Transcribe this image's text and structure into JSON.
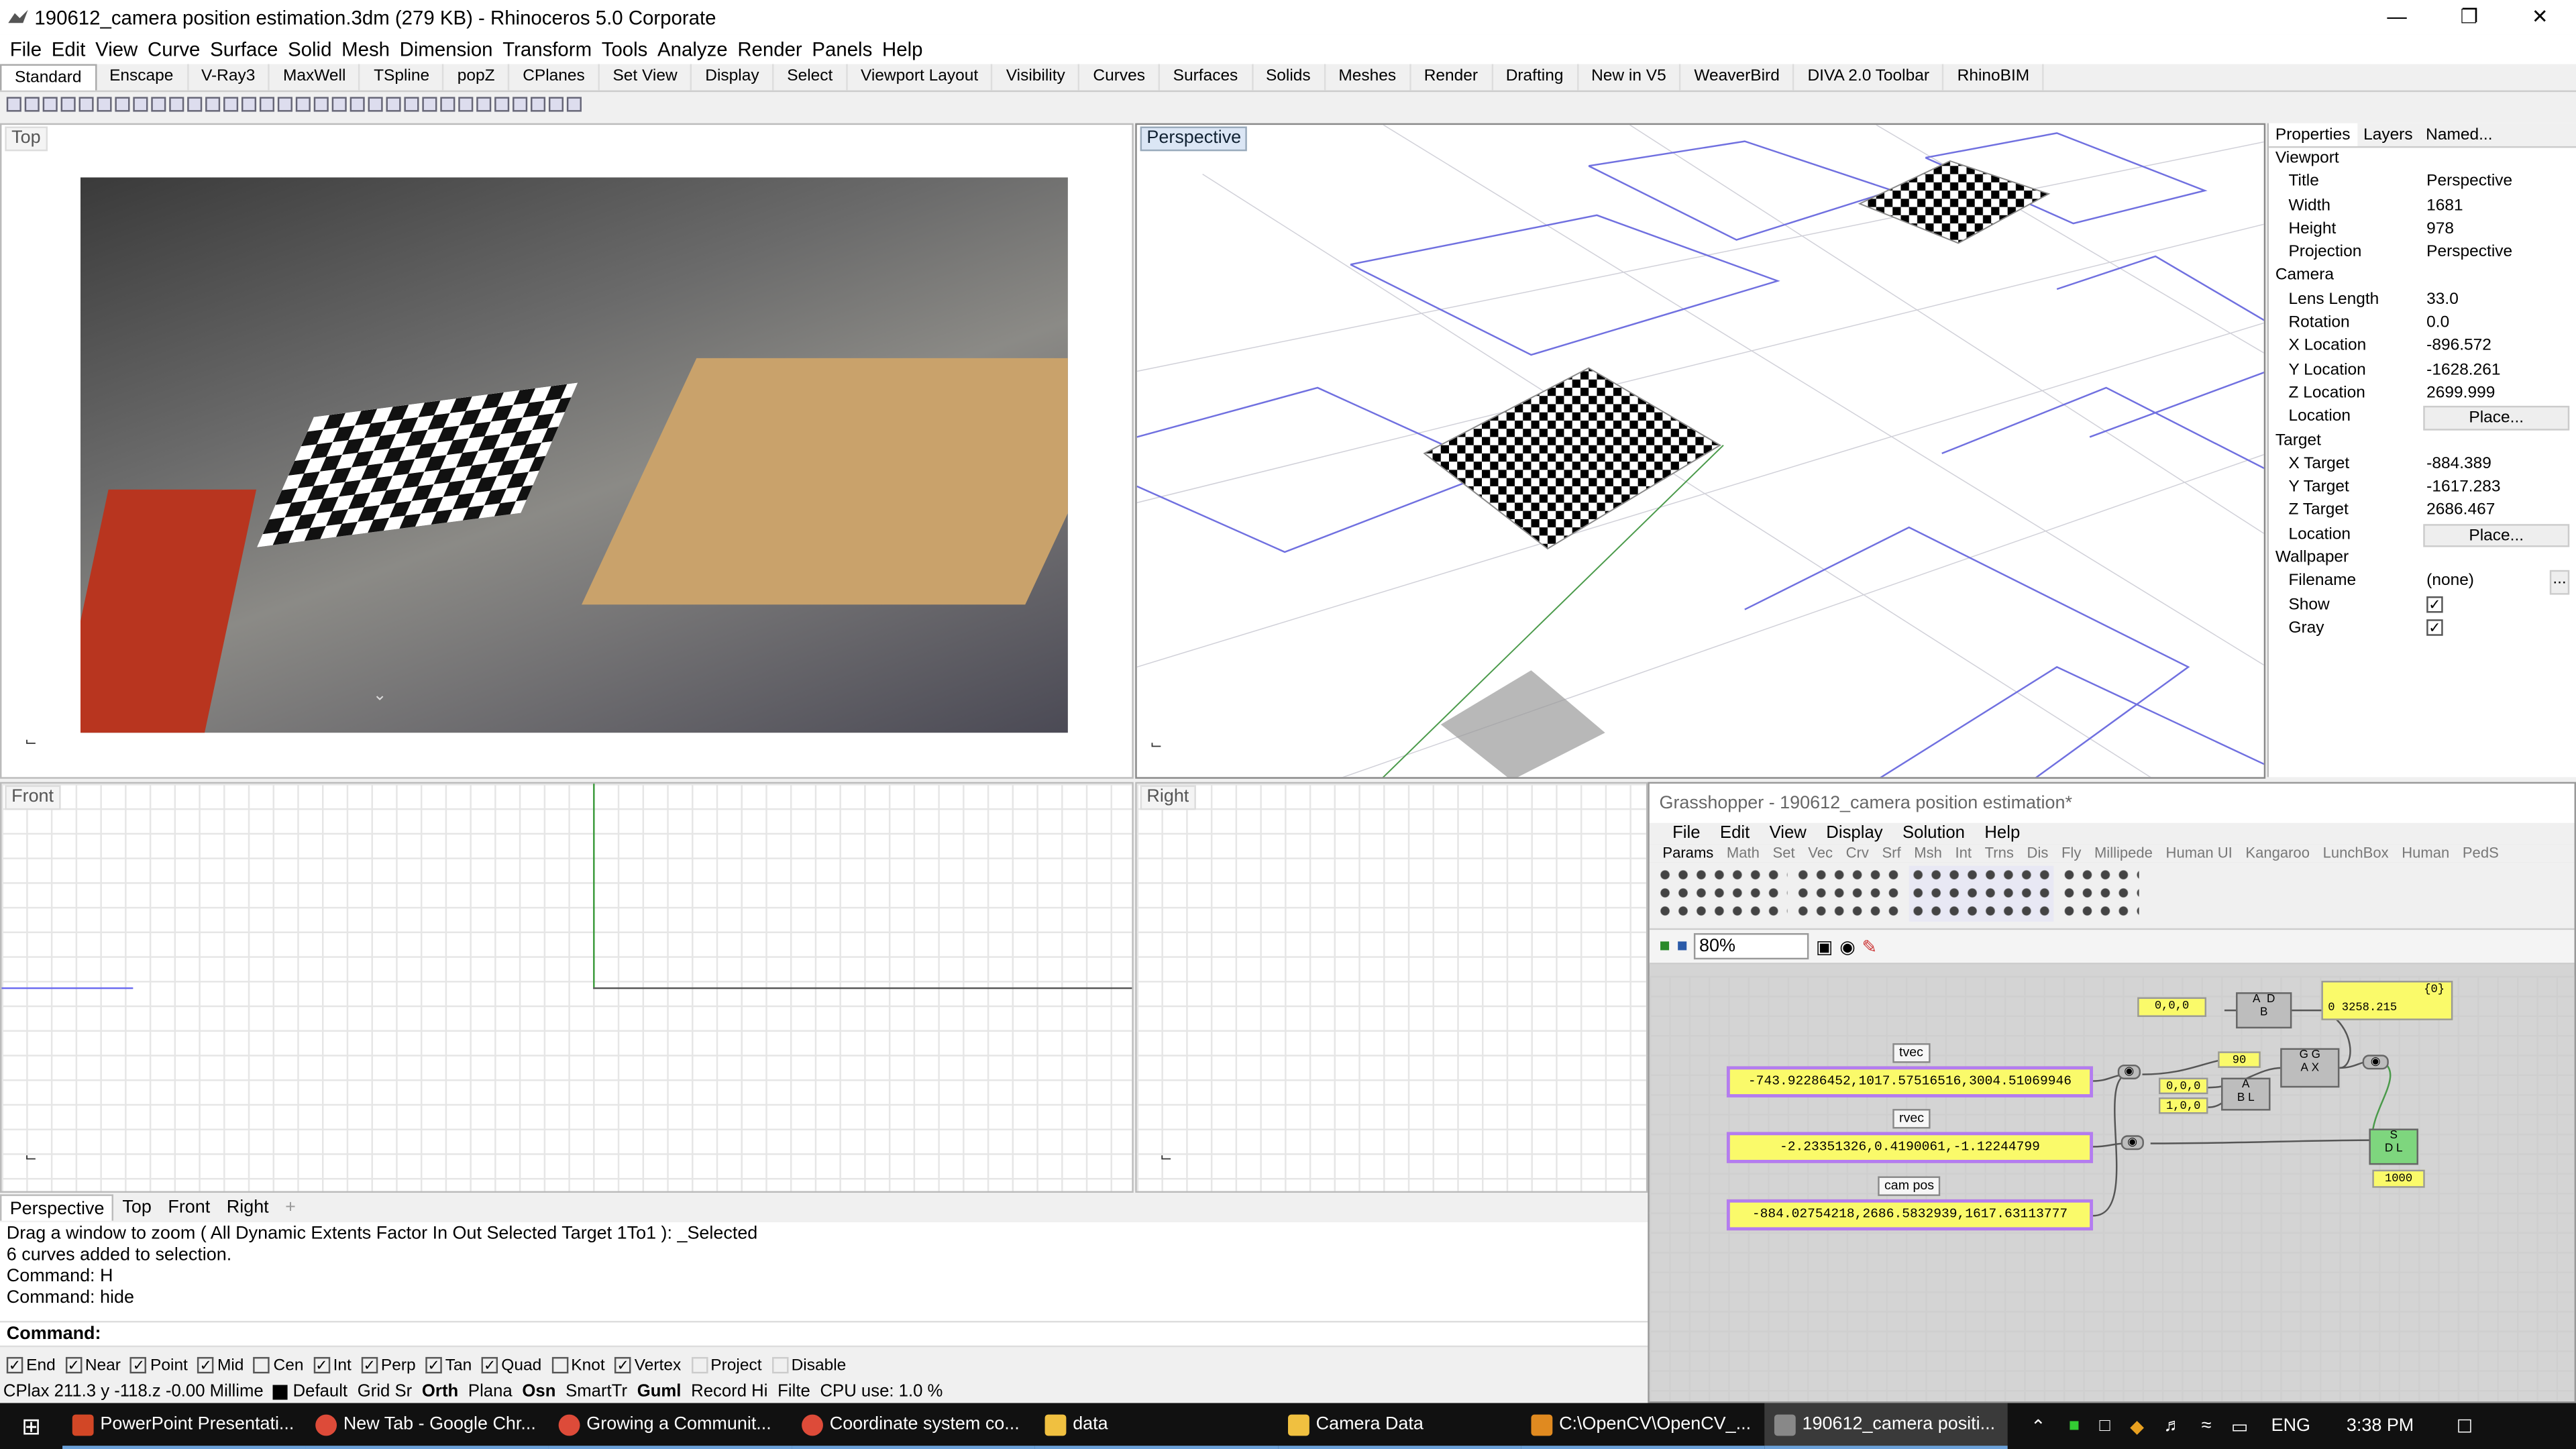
{
  "window": {
    "title": "190612_camera position estimation.3dm (279 KB) - Rhinoceros  5.0 Corporate"
  },
  "menu": [
    "File",
    "Edit",
    "View",
    "Curve",
    "Surface",
    "Solid",
    "Mesh",
    "Dimension",
    "Transform",
    "Tools",
    "Analyze",
    "Render",
    "Panels",
    "Help"
  ],
  "toolbar_tabs": [
    "Standard",
    "Enscape",
    "V-Ray3",
    "MaxWell",
    "TSpline",
    "popZ",
    "CPlanes",
    "Set View",
    "Display",
    "Select",
    "Viewport Layout",
    "Visibility",
    "Curves",
    "Surfaces",
    "Solids",
    "Meshes",
    "Render",
    "Drafting",
    "New in V5",
    "WeaverBird",
    "DIVA 2.0 Toolbar",
    "RhinoBIM"
  ],
  "viewports": {
    "top": "Top",
    "perspective": "Perspective",
    "front": "Front",
    "right": "Right"
  },
  "properties": {
    "tabs": [
      "Properties",
      "Layers",
      "Named..."
    ],
    "viewport_header": "Viewport",
    "title_k": "Title",
    "title_v": "Perspective",
    "width_k": "Width",
    "width_v": "1681",
    "height_k": "Height",
    "height_v": "978",
    "projection_k": "Projection",
    "projection_v": "Perspective",
    "camera_header": "Camera",
    "lens_k": "Lens Length",
    "lens_v": "33.0",
    "rotation_k": "Rotation",
    "rotation_v": "0.0",
    "xloc_k": "X Location",
    "xloc_v": "-896.572",
    "yloc_k": "Y Location",
    "yloc_v": "-1628.261",
    "zloc_k": "Z Location",
    "zloc_v": "2699.999",
    "loc_k": "Location",
    "place_label": "Place...",
    "target_header": "Target",
    "xt_k": "X Target",
    "xt_v": "-884.389",
    "yt_k": "Y Target",
    "yt_v": "-1617.283",
    "zt_k": "Z Target",
    "zt_v": "2686.467",
    "wallpaper_header": "Wallpaper",
    "filename_k": "Filename",
    "filename_v": "(none)",
    "browse_label": "...",
    "show_k": "Show",
    "gray_k": "Gray"
  },
  "view_tabs": [
    "Perspective",
    "Top",
    "Front",
    "Right"
  ],
  "command_history": [
    "Drag a window to zoom ( All  Dynamic  Extents  Factor  In  Out  Selected  Target  1To1 ): _Selected",
    "6 curves added to selection.",
    "Command: H",
    "Command: hide"
  ],
  "command_prompt": "Command:",
  "osnaps": [
    {
      "label": "End",
      "checked": true
    },
    {
      "label": "Near",
      "checked": true
    },
    {
      "label": "Point",
      "checked": true
    },
    {
      "label": "Mid",
      "checked": true
    },
    {
      "label": "Cen",
      "checked": false
    },
    {
      "label": "Int",
      "checked": true
    },
    {
      "label": "Perp",
      "checked": true
    },
    {
      "label": "Tan",
      "checked": true
    },
    {
      "label": "Quad",
      "checked": true
    },
    {
      "label": "Knot",
      "checked": false
    },
    {
      "label": "Vertex",
      "checked": true
    },
    {
      "label": "Project",
      "checked": false
    },
    {
      "label": "Disable",
      "checked": false
    }
  ],
  "status": {
    "coords": "CPlax 211.3 y -118.z -0.00 Millime",
    "layer": "Default",
    "grid": "Grid Sr",
    "ortho": "Orth",
    "planar": "Plana",
    "osnap": "Osn",
    "smarttrack": "SmartTr",
    "gumball": "Guml",
    "record": "Record Hi",
    "filter": "Filte",
    "cpu": "CPU use: 1.0 %"
  },
  "grasshopper": {
    "title": "Grasshopper - 190612_camera position estimation*",
    "menu": [
      "File",
      "Edit",
      "View",
      "Display",
      "Solution",
      "Help"
    ],
    "tabs": [
      "Params",
      "Math",
      "Set",
      "Vec",
      "Crv",
      "Srf",
      "Msh",
      "Int",
      "Trns",
      "Dis",
      "Fly",
      "Millipede",
      "Human UI",
      "Kangaroo",
      "LunchBox",
      "Human",
      "PedS"
    ],
    "zoom": "80%",
    "tvec_label": "tvec",
    "tvec_value": "-743.92286452,1017.57516516,3004.51069946",
    "rvec_label": "rvec",
    "rvec_value": "-2.23351326,0.4190061,-1.12244799",
    "campos_label": "cam pos",
    "campos_value": "-884.02754218,2686.5832939,1617.63113777",
    "origin_value": "0,0,0",
    "dist_header": "{0}",
    "dist_value": "0 3258.215",
    "angle_value": "90",
    "zero_value": "0,0,0",
    "axis_value": "1,0,0",
    "length_value": "1000"
  },
  "taskbar": {
    "items": [
      "PowerPoint Presentati...",
      "New Tab - Google Chr...",
      "Growing a Communit...",
      "Coordinate system co...",
      "data",
      "Camera Data",
      "C:\\OpenCV\\OpenCV_...",
      "190612_camera positi..."
    ],
    "lang": "ENG",
    "time": "3:38 PM"
  }
}
